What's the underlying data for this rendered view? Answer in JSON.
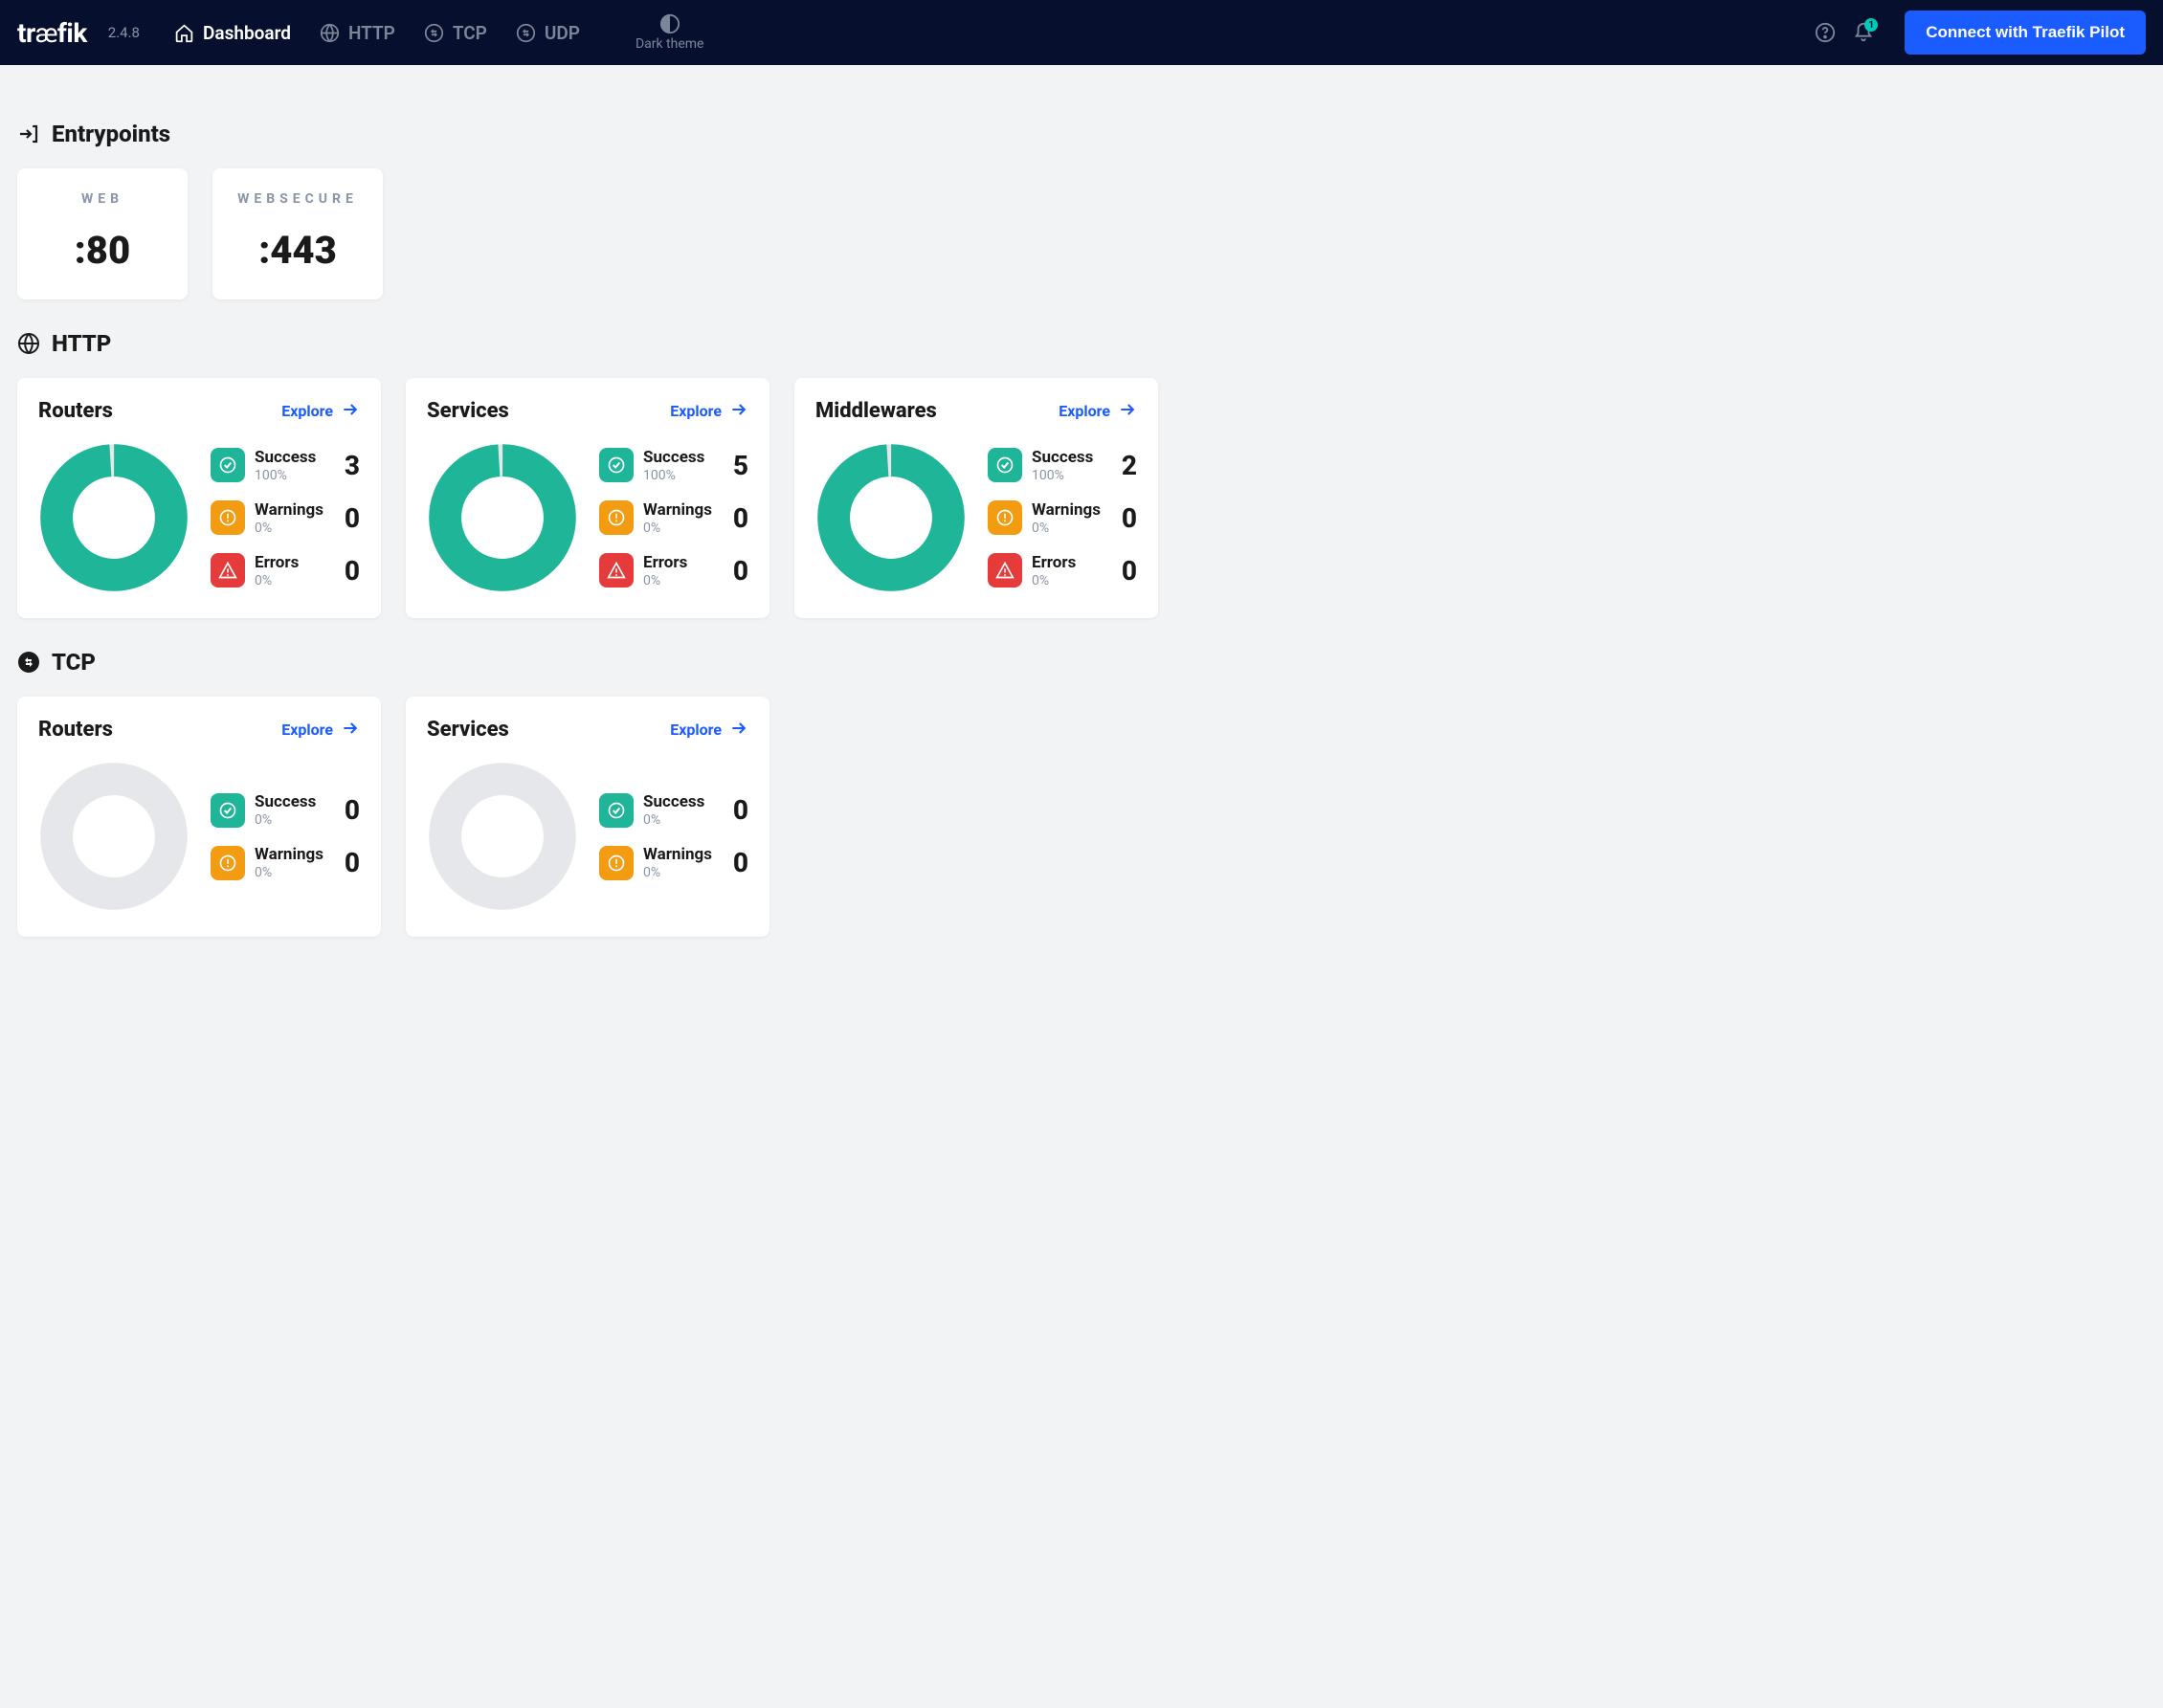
{
  "header": {
    "logo": "træfik",
    "version": "2.4.8",
    "nav": {
      "dashboard": "Dashboard",
      "http": "HTTP",
      "tcp": "TCP",
      "udp": "UDP"
    },
    "theme_toggle": "Dark theme",
    "notification_badge": "1",
    "pilot_button": "Connect with Traefik Pilot"
  },
  "sections": {
    "entrypoints_title": "Entrypoints",
    "http_title": "HTTP",
    "tcp_title": "TCP"
  },
  "entrypoints": [
    {
      "name": "WEB",
      "port": ":80"
    },
    {
      "name": "WEBSECURE",
      "port": ":443"
    }
  ],
  "labels": {
    "explore": "Explore",
    "success": "Success",
    "warnings": "Warnings",
    "errors": "Errors"
  },
  "colors": {
    "success": "#1fb598",
    "warning": "#f39c12",
    "error": "#e53b3b",
    "empty": "#e5e7eb",
    "accent": "#1a5cff"
  },
  "http_cards": [
    {
      "title": "Routers",
      "success": {
        "pct": "100%",
        "count": "3"
      },
      "warnings": {
        "pct": "0%",
        "count": "0"
      },
      "errors": {
        "pct": "0%",
        "count": "0"
      }
    },
    {
      "title": "Services",
      "success": {
        "pct": "100%",
        "count": "5"
      },
      "warnings": {
        "pct": "0%",
        "count": "0"
      },
      "errors": {
        "pct": "0%",
        "count": "0"
      }
    },
    {
      "title": "Middlewares",
      "success": {
        "pct": "100%",
        "count": "2"
      },
      "warnings": {
        "pct": "0%",
        "count": "0"
      },
      "errors": {
        "pct": "0%",
        "count": "0"
      }
    }
  ],
  "tcp_cards": [
    {
      "title": "Routers",
      "success": {
        "pct": "0%",
        "count": "0"
      },
      "warnings": {
        "pct": "0%",
        "count": "0"
      }
    },
    {
      "title": "Services",
      "success": {
        "pct": "0%",
        "count": "0"
      },
      "warnings": {
        "pct": "0%",
        "count": "0"
      }
    }
  ],
  "chart_data": [
    {
      "type": "pie",
      "title": "HTTP Routers",
      "categories": [
        "Success",
        "Warnings",
        "Errors"
      ],
      "values": [
        3,
        0,
        0
      ]
    },
    {
      "type": "pie",
      "title": "HTTP Services",
      "categories": [
        "Success",
        "Warnings",
        "Errors"
      ],
      "values": [
        5,
        0,
        0
      ]
    },
    {
      "type": "pie",
      "title": "HTTP Middlewares",
      "categories": [
        "Success",
        "Warnings",
        "Errors"
      ],
      "values": [
        2,
        0,
        0
      ]
    },
    {
      "type": "pie",
      "title": "TCP Routers",
      "categories": [
        "Success",
        "Warnings",
        "Errors"
      ],
      "values": [
        0,
        0,
        0
      ]
    },
    {
      "type": "pie",
      "title": "TCP Services",
      "categories": [
        "Success",
        "Warnings",
        "Errors"
      ],
      "values": [
        0,
        0,
        0
      ]
    }
  ]
}
